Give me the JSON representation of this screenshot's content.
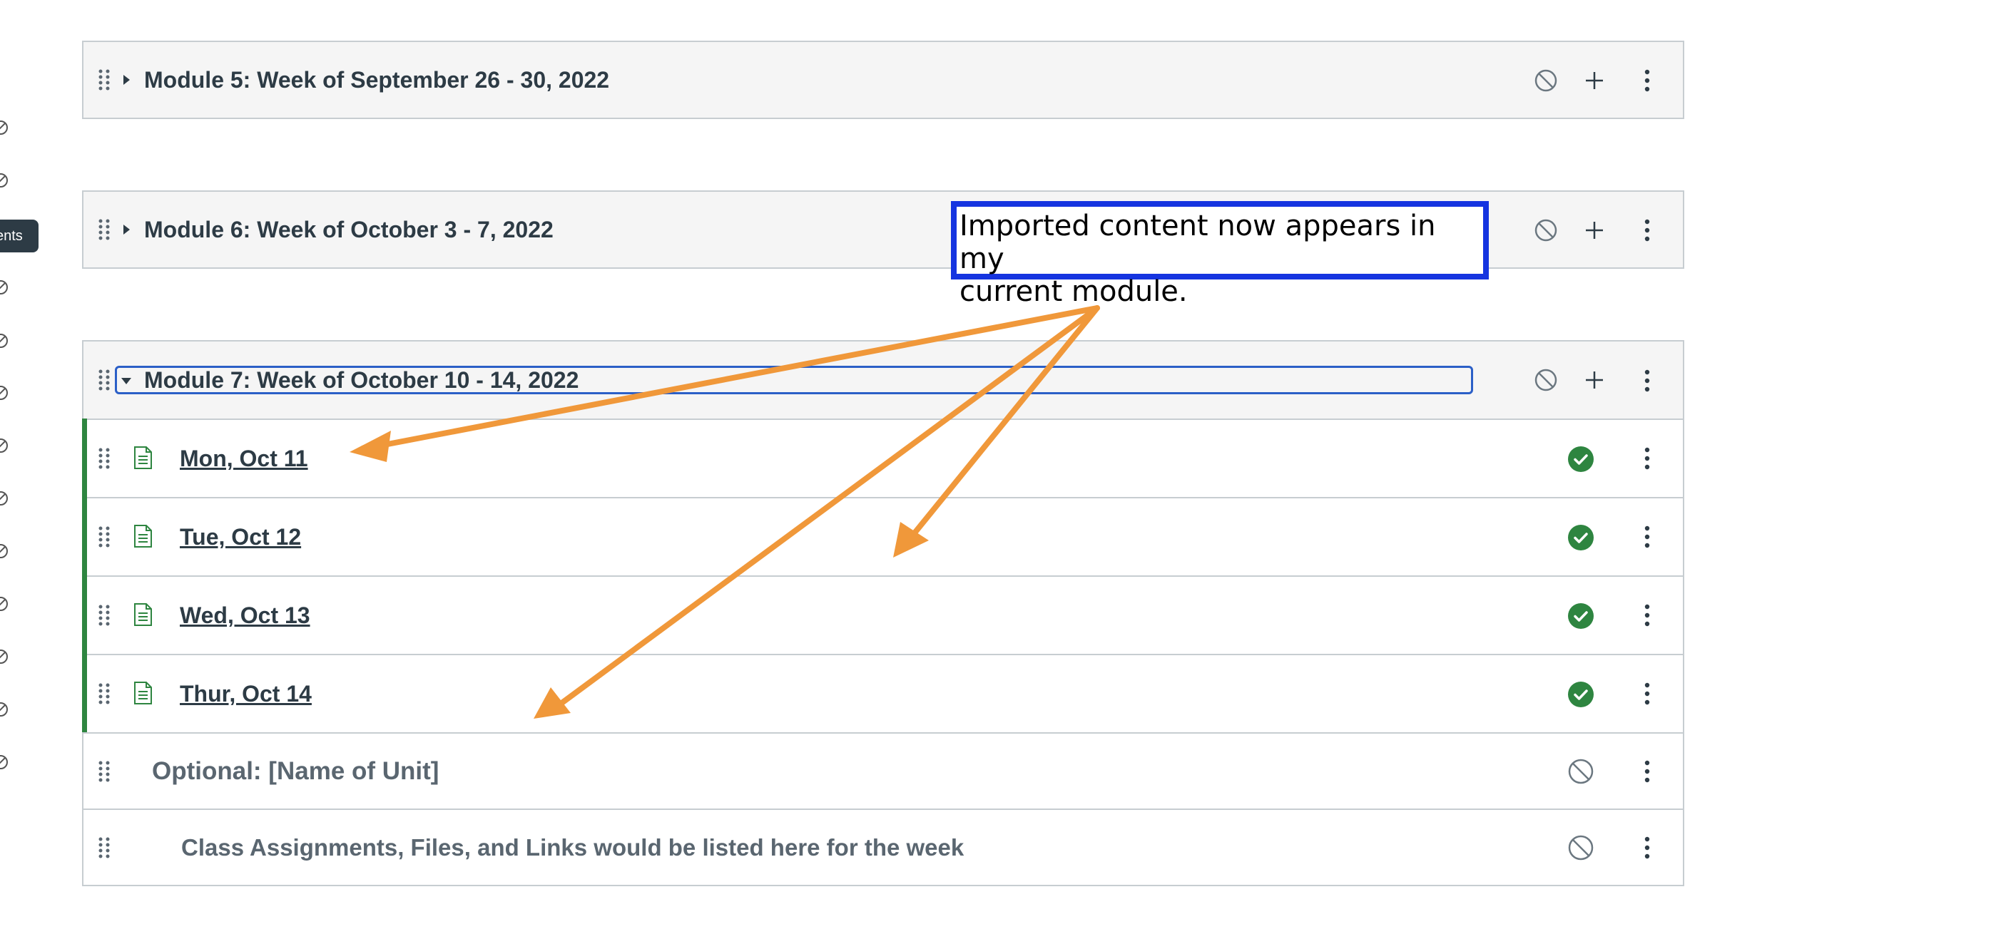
{
  "left_rail": {
    "tooltip_text": "ents",
    "icon_name": "unpublished-icon"
  },
  "modules": [
    {
      "title": "Module 5: Week of September 26 - 30, 2022",
      "expanded": false,
      "header_icons": [
        "unpublished-icon",
        "plus-icon",
        "kebab-icon"
      ]
    },
    {
      "title": "Module 6: Week of October 3 - 7, 2022",
      "expanded": false,
      "header_icons": [
        "unpublished-icon",
        "plus-icon",
        "kebab-icon"
      ]
    },
    {
      "title": "Module 7: Week of October 10 - 14, 2022",
      "expanded": true,
      "focused": true,
      "header_icons": [
        "unpublished-icon",
        "plus-icon",
        "kebab-icon"
      ],
      "items": [
        {
          "title": "Mon, Oct 11",
          "type": "page",
          "published": true
        },
        {
          "title": "Tue, Oct 12",
          "type": "page",
          "published": true
        },
        {
          "title": "Wed, Oct 13",
          "type": "page",
          "published": true
        },
        {
          "title": "Thur, Oct 14",
          "type": "page",
          "published": true
        }
      ],
      "sub_headers": [
        {
          "text": "Optional: [Name of Unit]",
          "published": false
        },
        {
          "text": "Class Assignments, Files, and Links would be listed here for the week",
          "published": false
        }
      ]
    }
  ],
  "annotation": {
    "line1": "Imported content now appears in my",
    "line2": "current module.",
    "border_color": "#1534e0",
    "arrow_color": "#f0983a"
  },
  "colors": {
    "published_green": "#2e8540",
    "header_bg": "#f5f5f5",
    "focus_blue": "#2b5fc7",
    "text": "#2d3b45"
  }
}
